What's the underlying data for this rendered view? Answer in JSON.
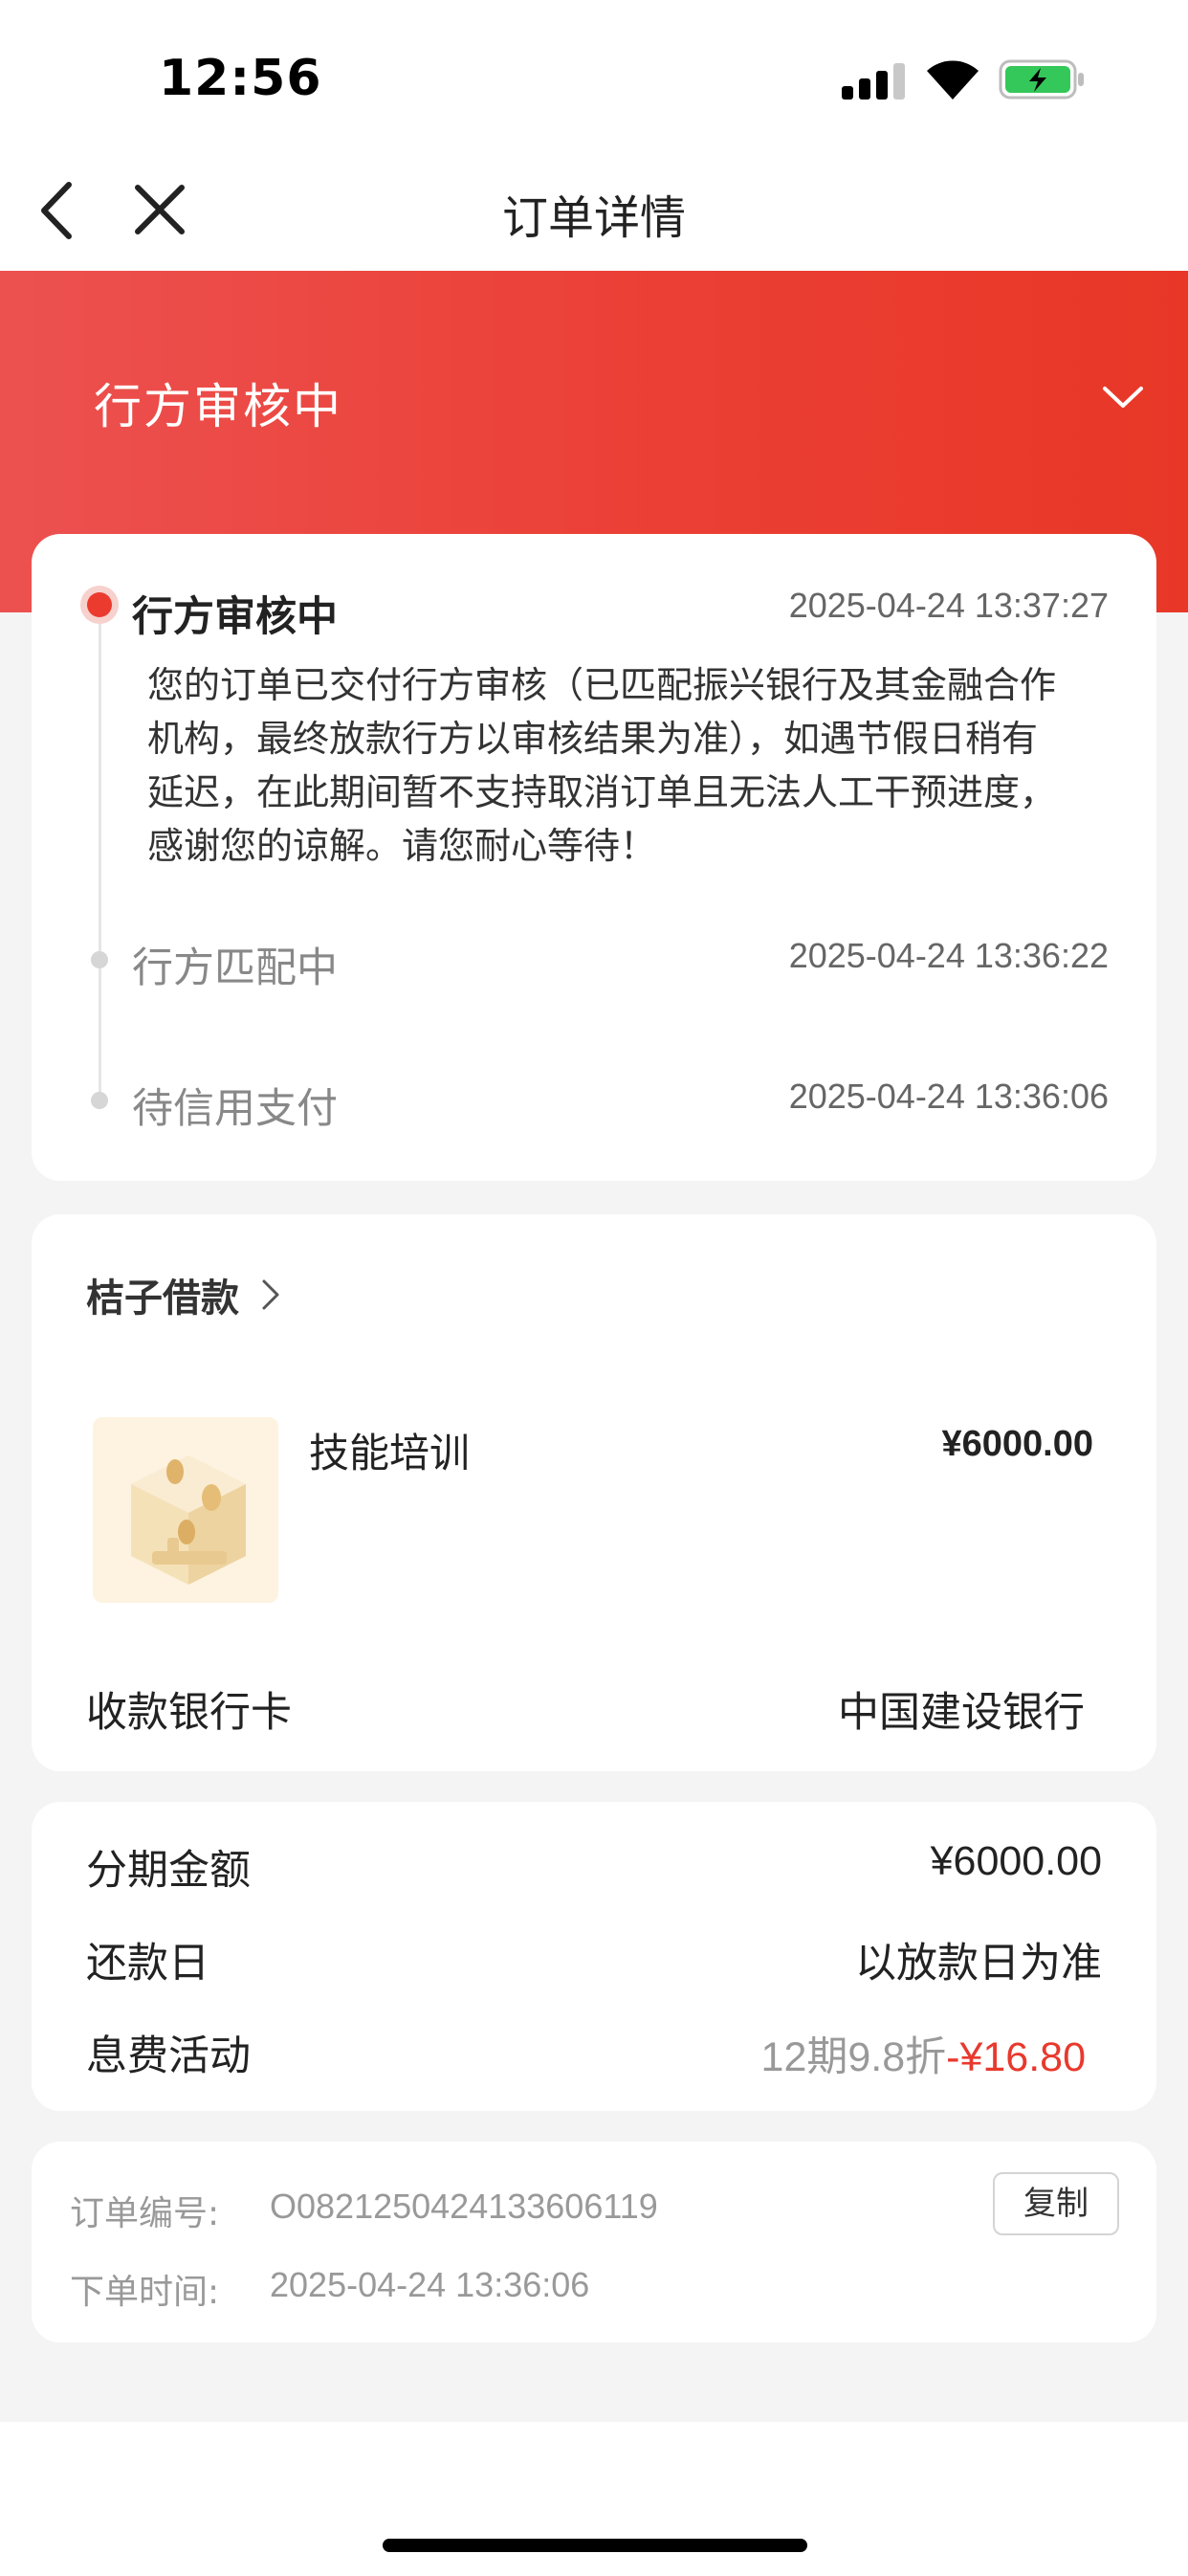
{
  "status_bar": {
    "time": "12:56"
  },
  "nav": {
    "title": "订单详情"
  },
  "hero": {
    "status": "行方审核中"
  },
  "timeline": [
    {
      "title": "行方审核中",
      "time": "2025-04-24 13:37:27",
      "description_lines": [
        "您的订单已交付行方审核（已匹配振兴银行及其金融合作",
        "机构，最终放款行方以审核结果为准），如遇节假日稍有",
        "延迟，在此期间暂不支持取消订单且无法人工干预进度，",
        "感谢您的谅解。请您耐心等待！"
      ]
    },
    {
      "title": "行方匹配中",
      "time": "2025-04-24 13:36:22"
    },
    {
      "title": "待信用支付",
      "time": "2025-04-24 13:36:06"
    }
  ],
  "product": {
    "merchant": "桔子借款",
    "name": "技能培训",
    "price": "¥6000.00",
    "bank_label": "收款银行卡",
    "bank_value": "中国建设银行"
  },
  "terms": {
    "amount_label": "分期金额",
    "amount_value": "¥6000.00",
    "repay_label": "还款日",
    "repay_value": "以放款日为准",
    "promo_label": "息费活动",
    "promo_desc": "12期9.8折",
    "promo_amount": "-¥16.80"
  },
  "order": {
    "number_label": "订单编号:",
    "number_value": "O0821250424133606119",
    "copy_label": "复制",
    "time_label": "下单时间:",
    "time_value": "2025-04-24 13:36:06"
  },
  "colors": {
    "accent": "#eb3b2f",
    "hero_start": "#ec5150",
    "hero_end": "#e83727"
  }
}
